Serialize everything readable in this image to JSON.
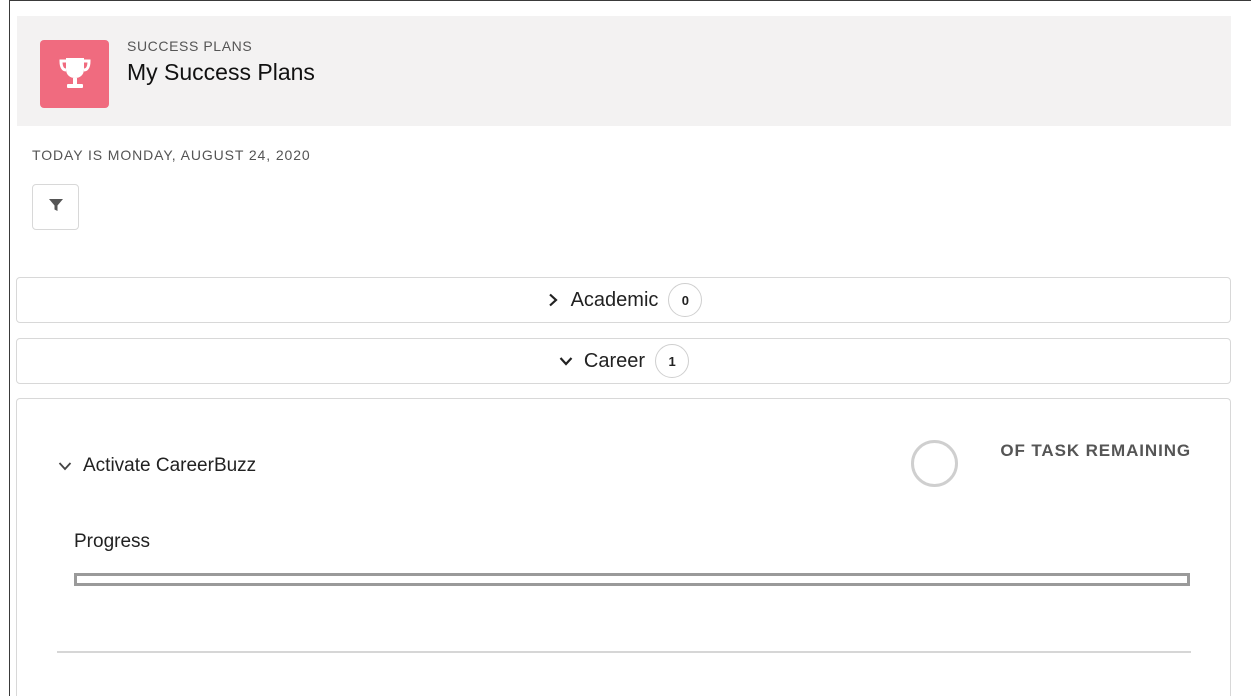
{
  "header": {
    "icon": "trophy-icon",
    "eyebrow": "SUCCESS PLANS",
    "title": "My Success Plans"
  },
  "today_text": "TODAY IS MONDAY, AUGUST 24, 2020",
  "filter": {
    "icon": "filter-icon"
  },
  "sections": [
    {
      "label": "Academic",
      "count": "0",
      "expanded": false,
      "icon": "chevron-right-icon"
    },
    {
      "label": "Career",
      "count": "1",
      "expanded": true,
      "icon": "chevron-down-icon"
    }
  ],
  "career_plan": {
    "title": "Activate CareerBuzz",
    "toggle_icon": "chevron-down-icon",
    "task_remaining_label": "OF TASK REMAINING",
    "progress_label": "Progress",
    "progress_percent": 0
  },
  "colors": {
    "header_bg": "#f3f2f2",
    "icon_accent": "#f06b7f",
    "border": "#d8d8d8",
    "progress_border": "#9a9a9a"
  }
}
